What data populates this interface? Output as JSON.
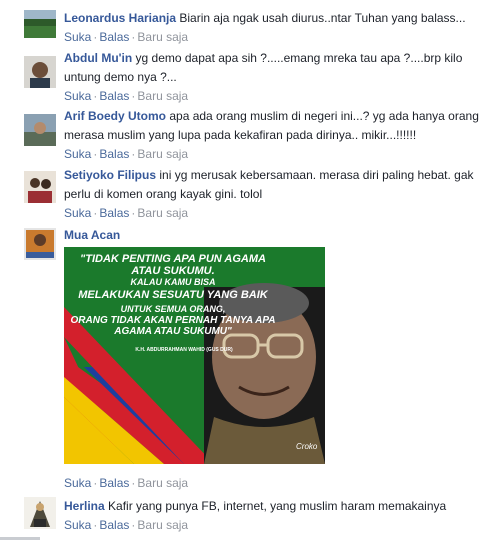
{
  "comments": [
    {
      "author": "Leonardus Harianja",
      "text": "Biarin aja ngak usah diurus..ntar Tuhan yang balass...",
      "actions": [
        "Suka",
        "Balas"
      ],
      "time": "Baru saja"
    },
    {
      "author": "Abdul Mu'in",
      "text": "yg demo dapat apa sih ?.....emang mreka tau apa ?....brp kilo untung demo nya ?...",
      "actions": [
        "Suka",
        "Balas"
      ],
      "time": "Baru saja"
    },
    {
      "author": "Arif Boedy Utomo",
      "text": "apa ada orang muslim di negeri ini...? yg ada hanya orang merasa muslim yang lupa pada kekafiran pada dirinya.. mikir...!!!!!!",
      "actions": [
        "Suka",
        "Balas"
      ],
      "time": "Baru saja"
    },
    {
      "author": "Setiyoko Filipus",
      "text": "ini yg merusak kebersamaan. merasa diri paling hebat. gak perlu di komen orang kayak gini. tolol",
      "actions": [
        "Suka",
        "Balas"
      ],
      "time": "Baru saja"
    },
    {
      "author": "Mua Acan",
      "text": "",
      "actions": [
        "Suka",
        "Balas"
      ],
      "time": "Baru saja",
      "attachment": {
        "quote_lines": [
          "\"TIDAK PENTING APA PUN AGAMA ATAU SUKUMU.",
          "KALAU KAMU BISA",
          "MELAKUKAN SESUATU YANG BAIK",
          "UNTUK SEMUA ORANG,",
          "ORANG TIDAK AKAN PERNAH TANYA APA AGAMA ATAU SUKUMU\""
        ],
        "attribution": "K.H. ABDURRAHMAN WAHID (GUS DUR)",
        "signature": "Croko",
        "colors": {
          "green": "#1b7a2c",
          "red": "#d3202c",
          "yellow": "#f2c500",
          "blue": "#1d3f9e"
        }
      }
    },
    {
      "author": "Herlina",
      "text": "Kafir yang punya FB, internet, yang muslim haram memakainya",
      "actions": [
        "Suka",
        "Balas"
      ],
      "time": "Baru saja"
    }
  ]
}
